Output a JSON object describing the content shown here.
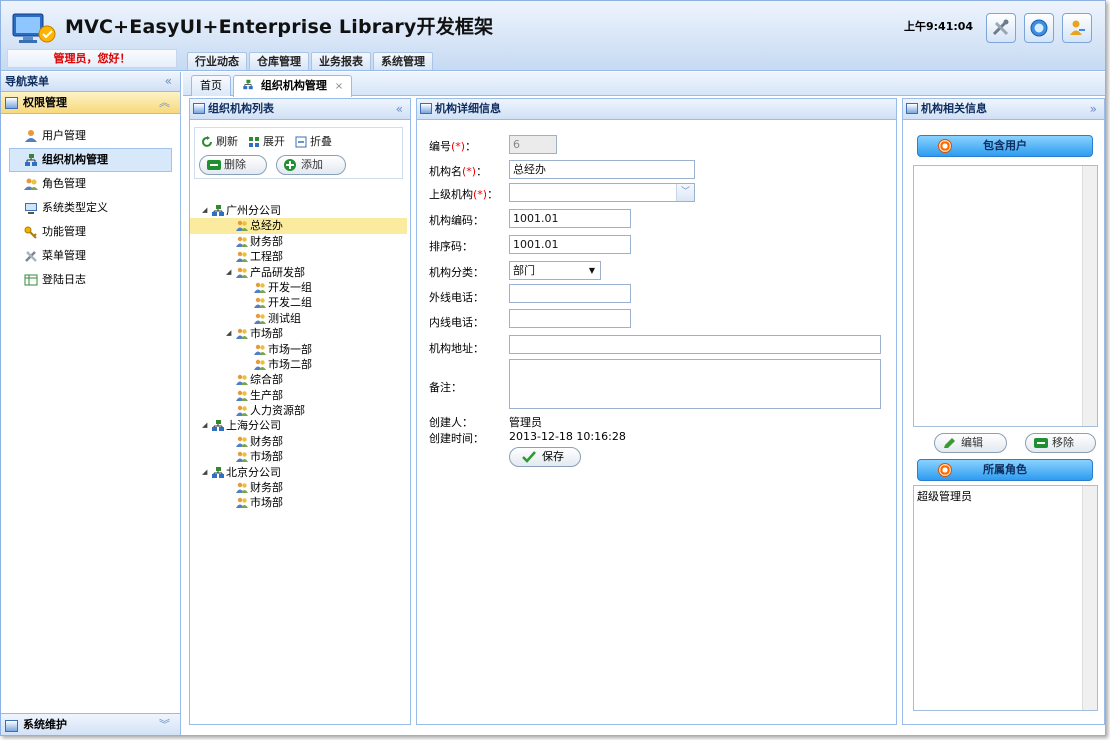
{
  "app": {
    "title": "MVC+EasyUI+Enterprise Library开发框架",
    "clock": "上午9:41:04"
  },
  "header": {
    "welcome": "管理员，您好！",
    "buttons": [
      "tools-icon",
      "info-icon",
      "user-key-icon"
    ]
  },
  "topnav": [
    "行业动态",
    "仓库管理",
    "业务报表",
    "系统管理"
  ],
  "leftnav": {
    "title": "导航菜单",
    "section": "权限管理",
    "items": [
      {
        "label": "用户管理",
        "icon": "user-icon"
      },
      {
        "label": "组织机构管理",
        "icon": "org-icon"
      },
      {
        "label": "角色管理",
        "icon": "role-icon"
      },
      {
        "label": "系统类型定义",
        "icon": "monitor-icon"
      },
      {
        "label": "功能管理",
        "icon": "key-icon"
      },
      {
        "label": "菜单管理",
        "icon": "tools-icon"
      },
      {
        "label": "登陆日志",
        "icon": "log-icon"
      }
    ],
    "footer": "系统维护"
  },
  "tabs": {
    "home": "首页",
    "current": "组织机构管理",
    "close": "×"
  },
  "tree_panel": {
    "title": "组织机构列表",
    "refresh": "刷新",
    "expand": "展开",
    "collapse": "折叠",
    "delete": "删除",
    "add": "添加",
    "nodes": [
      {
        "label": "广州分公司",
        "level": 1,
        "arrow": true,
        "type": "company"
      },
      {
        "label": "总经办",
        "level": 2,
        "selected": true,
        "type": "dept"
      },
      {
        "label": "财务部",
        "level": 2,
        "type": "dept"
      },
      {
        "label": "工程部",
        "level": 2,
        "type": "dept"
      },
      {
        "label": "产品研发部",
        "level": 2,
        "arrow": true,
        "type": "dept"
      },
      {
        "label": "开发一组",
        "level": 3,
        "type": "dept"
      },
      {
        "label": "开发二组",
        "level": 3,
        "type": "dept"
      },
      {
        "label": "测试组",
        "level": 3,
        "type": "dept"
      },
      {
        "label": "市场部",
        "level": 2,
        "arrow": true,
        "type": "dept"
      },
      {
        "label": "市场一部",
        "level": 3,
        "type": "dept"
      },
      {
        "label": "市场二部",
        "level": 3,
        "type": "dept"
      },
      {
        "label": "综合部",
        "level": 2,
        "type": "dept"
      },
      {
        "label": "生产部",
        "level": 2,
        "type": "dept"
      },
      {
        "label": "人力资源部",
        "level": 2,
        "type": "dept"
      },
      {
        "label": "上海分公司",
        "level": 1,
        "arrow": true,
        "type": "company"
      },
      {
        "label": "财务部",
        "level": 2,
        "type": "dept"
      },
      {
        "label": "市场部",
        "level": 2,
        "type": "dept"
      },
      {
        "label": "北京分公司",
        "level": 1,
        "arrow": true,
        "type": "company"
      },
      {
        "label": "财务部",
        "level": 2,
        "type": "dept"
      },
      {
        "label": "市场部",
        "level": 2,
        "type": "dept"
      }
    ]
  },
  "detail": {
    "title": "机构详细信息",
    "labels": {
      "id": "编号",
      "name": "机构名",
      "parent": "上级机构",
      "req": "(*)",
      "colon": "：",
      "code": "机构编码：",
      "sort": "排序码：",
      "category": "机构分类：",
      "outer_phone": "外线电话：",
      "inner_phone": "内线电话：",
      "address": "机构地址：",
      "remark": "备注：",
      "creator": "创建人：",
      "created_at": "创建时间："
    },
    "values": {
      "id": "6",
      "name": "总经办",
      "parent": "",
      "code": "1001.01",
      "sort": "1001.01",
      "category": "部门",
      "outer_phone": "",
      "inner_phone": "",
      "address": "",
      "remark": "",
      "creator": "管理员",
      "created_at": "2013-12-18 10:16:28"
    },
    "save": "保存"
  },
  "related": {
    "title": "机构相关信息",
    "users_header": "包含用户",
    "users": [],
    "edit": "编辑",
    "remove": "移除",
    "roles_header": "所属角色",
    "roles": [
      "超级管理员"
    ]
  },
  "colors": {
    "accent": "#2e9cf0",
    "header_bg": "#c6daf3",
    "selected_tree": "#fbeb9f",
    "required": "#e00000",
    "welcome": "#dd0000"
  }
}
